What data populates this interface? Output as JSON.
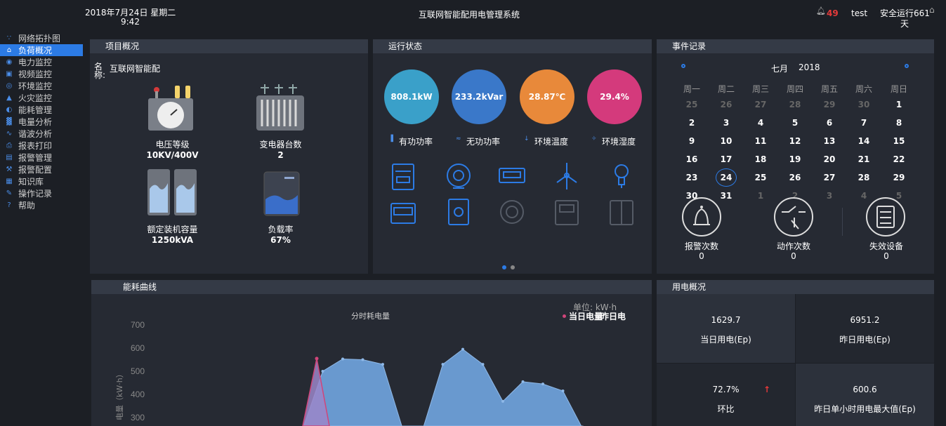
{
  "header": {
    "date": "2018年7月24日 星期二",
    "time": "9:42",
    "title": "互联网智能配用电管理系统",
    "alarm_count": "49",
    "username": "test",
    "safe_run_label": "安全运行661",
    "safe_run_unit": "天"
  },
  "sidebar": {
    "items": [
      {
        "label": "网络拓扑图",
        "icon": "topology-icon"
      },
      {
        "label": "负荷概况",
        "icon": "home-icon",
        "active": true
      },
      {
        "label": "电力监控",
        "icon": "power-monitor-icon"
      },
      {
        "label": "视频监控",
        "icon": "video-icon"
      },
      {
        "label": "环境监控",
        "icon": "environment-icon"
      },
      {
        "label": "火灾监控",
        "icon": "fire-icon"
      },
      {
        "label": "能耗管理",
        "icon": "energy-icon"
      },
      {
        "label": "电量分析",
        "icon": "bar-chart-icon"
      },
      {
        "label": "谐波分析",
        "icon": "harmonic-icon"
      },
      {
        "label": "报表打印",
        "icon": "print-icon"
      },
      {
        "label": "报警管理",
        "icon": "alarm-manage-icon"
      },
      {
        "label": "报警配置",
        "icon": "alarm-config-icon"
      },
      {
        "label": "知识库",
        "icon": "knowledge-icon"
      },
      {
        "label": "操作记录",
        "icon": "record-icon"
      },
      {
        "label": "帮助",
        "icon": "help-icon"
      }
    ]
  },
  "project": {
    "title": "项目概况",
    "name_label": "名称:",
    "name_value": "互联网智能配",
    "stats": [
      {
        "label": "电压等级",
        "value": "10KV/400V"
      },
      {
        "label": "变电器台数",
        "value": "2"
      },
      {
        "label": "额定装机容量",
        "value": "1250kVA"
      },
      {
        "label": "负载率",
        "value": "67%"
      }
    ]
  },
  "status": {
    "title": "运行状态",
    "metrics": [
      {
        "value": "808.1kW",
        "label": "有功功率",
        "color": "#3aa0c9"
      },
      {
        "value": "233.2kVar",
        "label": "无功功率",
        "color": "#3a78c9"
      },
      {
        "value": "28.87℃",
        "label": "环境温度",
        "color": "#e8893a"
      },
      {
        "value": "29.4%",
        "label": "环境湿度",
        "color": "#d43a7c"
      }
    ]
  },
  "events": {
    "title": "事件记录",
    "month": "七月",
    "year": "2018",
    "weekdays": [
      "周一",
      "周二",
      "周三",
      "周四",
      "周五",
      "周六",
      "周日"
    ],
    "rows": [
      [
        "25",
        "26",
        "27",
        "28",
        "29",
        "30",
        "1"
      ],
      [
        "2",
        "3",
        "4",
        "5",
        "6",
        "7",
        "8"
      ],
      [
        "9",
        "10",
        "11",
        "12",
        "13",
        "14",
        "15"
      ],
      [
        "16",
        "17",
        "18",
        "19",
        "20",
        "21",
        "22"
      ],
      [
        "23",
        "24",
        "25",
        "26",
        "27",
        "28",
        "29"
      ],
      [
        "30",
        "31",
        "1",
        "2",
        "3",
        "4",
        "5"
      ]
    ],
    "today": "24",
    "counters": [
      {
        "label": "报警次数",
        "value": "0"
      },
      {
        "label": "动作次数",
        "value": "0"
      },
      {
        "label": "失效设备",
        "value": "0"
      }
    ]
  },
  "energy": {
    "title": "能耗曲线",
    "unit": "单位: kW·h",
    "subtitle": "分时耗电量",
    "legend_today": "当日电量",
    "legend_yesterday": "昨日电",
    "ylabel": "电量（kW·h）"
  },
  "usage": {
    "title": "用电概况",
    "cells": [
      {
        "value": "1629.7",
        "label": "当日用电(Ep)"
      },
      {
        "value": "6951.2",
        "label": "昨日用电(Ep)"
      },
      {
        "value": "72.7%",
        "label": "环比"
      },
      {
        "value": "600.6",
        "label": "昨日单小时用电最大值(Ep)"
      }
    ]
  },
  "chart_data": {
    "type": "area",
    "title": "分时耗电量",
    "ylabel": "电量（kW·h）",
    "yticks": [
      700,
      600,
      500,
      400,
      300
    ],
    "ylim": [
      300,
      700
    ],
    "series": [
      {
        "name": "当日电量",
        "color": "#d0457a",
        "values": [
          null,
          250,
          555,
          250
        ]
      },
      {
        "name": "昨日电",
        "color": "#6fa3dc",
        "values": [
          250,
          500,
          553,
          550,
          530,
          250,
          250,
          530,
          595,
          530,
          370,
          455,
          445,
          415,
          250
        ]
      }
    ]
  }
}
